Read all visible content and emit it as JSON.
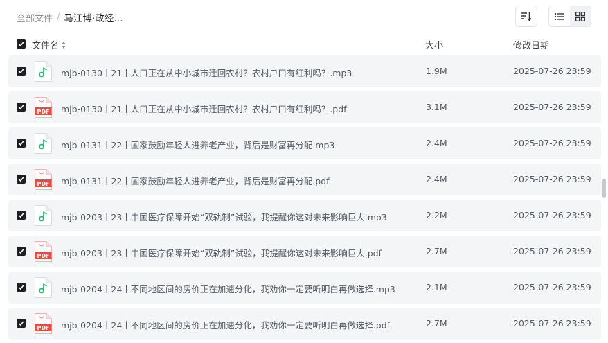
{
  "breadcrumb": {
    "root": "全部文件",
    "separator": "/",
    "current": "马江博·政经…"
  },
  "toolbar": {
    "sort_icon": "sort-desc-icon",
    "list_view_icon": "list-view-icon",
    "grid_view_icon": "grid-view-icon",
    "active_view": "list"
  },
  "table": {
    "columns": {
      "name": "文件名",
      "size": "大小",
      "modified": "修改日期"
    },
    "rows": [
      {
        "name": "mjb-0130丨21丨人口正在从中小城市迁回农村？农村户口有红利吗？.mp3",
        "type": "mp3",
        "size": "1.9M",
        "modified": "2025-07-26 23:59",
        "checked": true
      },
      {
        "name": "mjb-0130丨21丨人口正在从中小城市迁回农村？农村户口有红利吗？.pdf",
        "type": "pdf",
        "size": "3.1M",
        "modified": "2025-07-26 23:59",
        "checked": true
      },
      {
        "name": "mjb-0131丨22丨国家鼓励年轻人进养老产业，背后是财富再分配.mp3",
        "type": "mp3",
        "size": "2.4M",
        "modified": "2025-07-26 23:59",
        "checked": true
      },
      {
        "name": "mjb-0131丨22丨国家鼓励年轻人进养老产业，背后是财富再分配.pdf",
        "type": "pdf",
        "size": "2.4M",
        "modified": "2025-07-26 23:59",
        "checked": true
      },
      {
        "name": "mjb-0203丨23丨中国医疗保障开始“双轨制”试验，我提醒你这对未来影响巨大.mp3",
        "type": "mp3",
        "size": "2.2M",
        "modified": "2025-07-26 23:59",
        "checked": true
      },
      {
        "name": "mjb-0203丨23丨中国医疗保障开始“双轨制”试验，我提醒你这对未来影响巨大.pdf",
        "type": "pdf",
        "size": "2.7M",
        "modified": "2025-07-26 23:59",
        "checked": true
      },
      {
        "name": "mjb-0204丨24丨不同地区间的房价正在加速分化，我劝你一定要听明白再做选择.mp3",
        "type": "mp3",
        "size": "2.1M",
        "modified": "2025-07-26 23:59",
        "checked": true
      },
      {
        "name": "mjb-0204丨24丨不同地区间的房价正在加速分化，我劝你一定要听明白再做选择.pdf",
        "type": "pdf",
        "size": "2.7M",
        "modified": "2025-07-26 23:59",
        "checked": true
      }
    ]
  },
  "icons": {
    "pdf_label": "PDF",
    "audio_color": "#2eb872",
    "pdf_color": "#f0473e"
  }
}
